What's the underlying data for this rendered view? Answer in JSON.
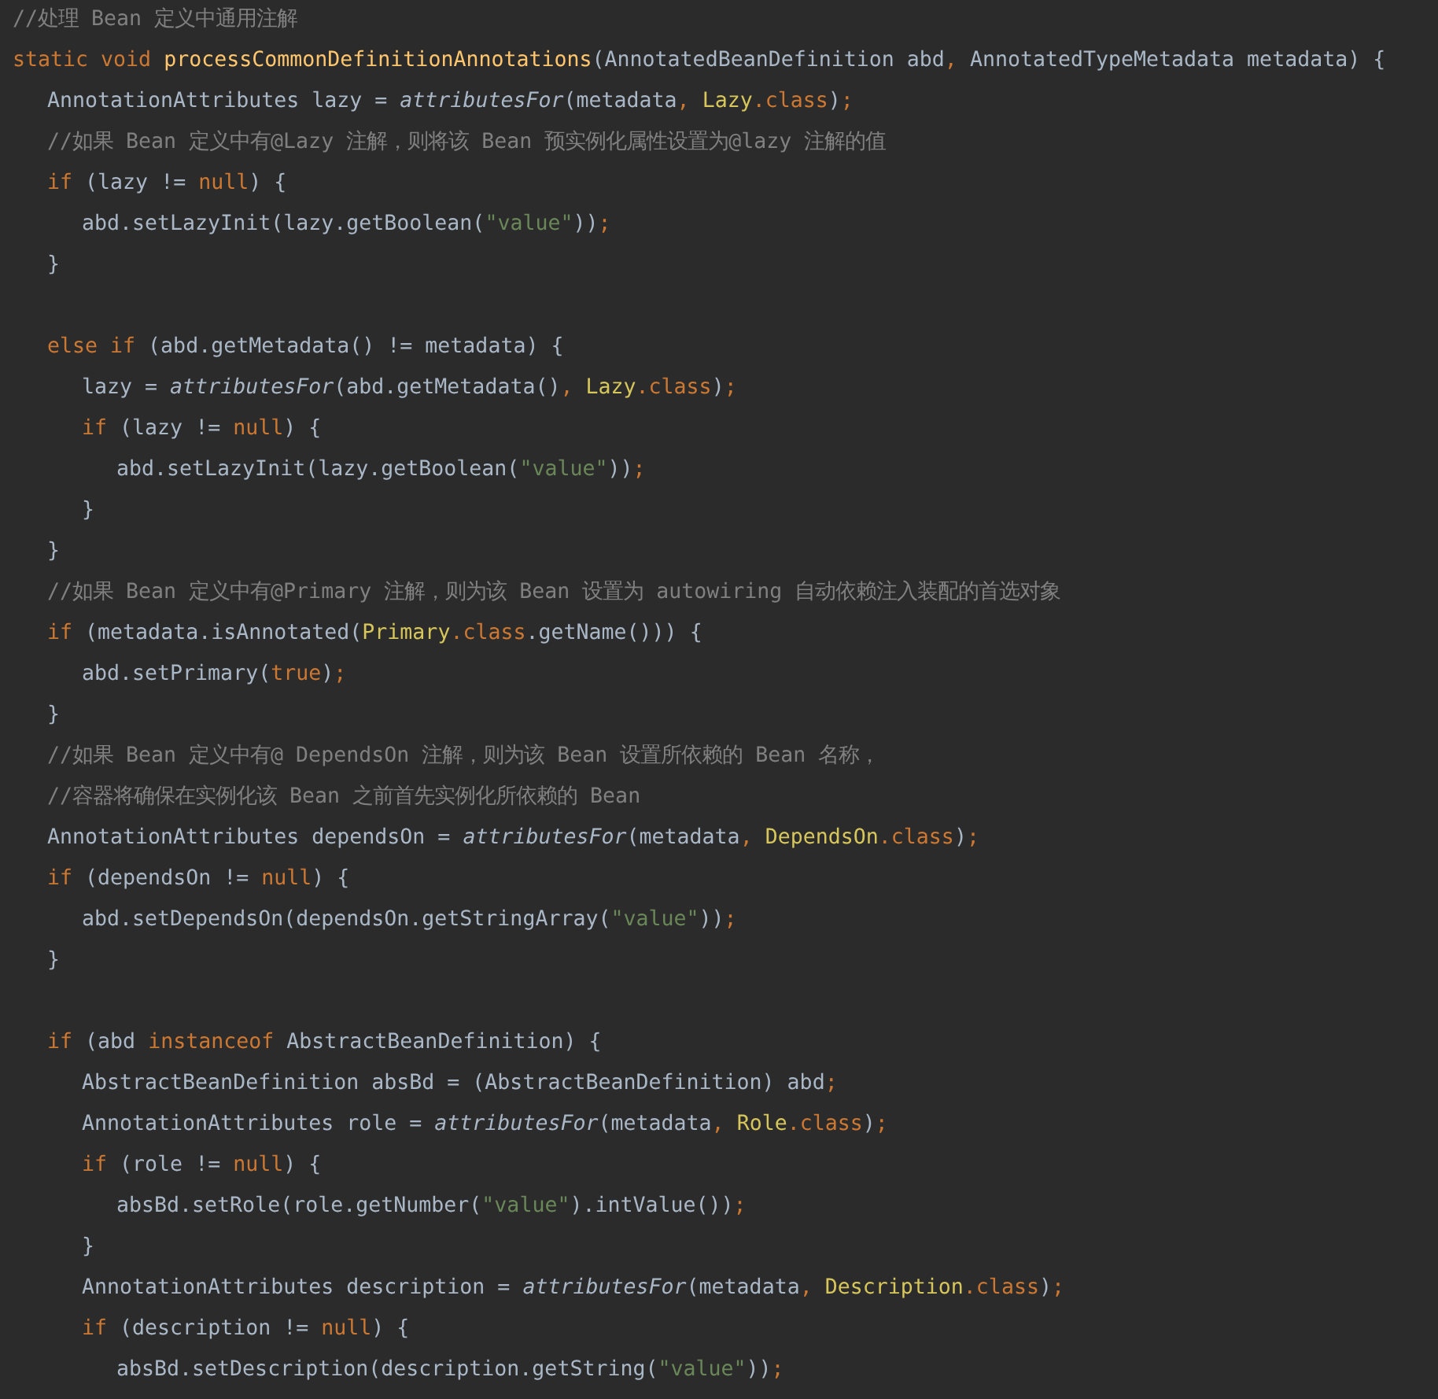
{
  "code_lines": [
    {
      "kind": "code",
      "tokens": [
        {
          "kind": "comment",
          "text": "//处理 Bean 定义中通用注解"
        }
      ]
    },
    {
      "kind": "code",
      "tokens": [
        {
          "kind": "keyword",
          "text": "static void "
        },
        {
          "kind": "method",
          "text": "processCommonDefinitionAnnotations"
        },
        {
          "kind": "plain",
          "text": "(AnnotatedBeanDefinition abd"
        },
        {
          "kind": "keyword",
          "text": ", "
        },
        {
          "kind": "plain",
          "text": "AnnotatedTypeMetadata metadata) {"
        }
      ],
      "children": [
        {
          "kind": "code",
          "tokens": [
            {
              "kind": "plain",
              "text": "AnnotationAttributes lazy = "
            },
            {
              "kind": "italic",
              "text": "attributesFor"
            },
            {
              "kind": "plain",
              "text": "(metadata"
            },
            {
              "kind": "keyword",
              "text": ", "
            },
            {
              "kind": "type",
              "text": "Lazy"
            },
            {
              "kind": "keyword",
              "text": ".class"
            },
            {
              "kind": "plain",
              "text": ")"
            },
            {
              "kind": "keyword",
              "text": ";"
            }
          ]
        },
        {
          "kind": "code",
          "tokens": [
            {
              "kind": "comment",
              "text": "//如果 Bean 定义中有@Lazy 注解，则将该 Bean 预实例化属性设置为@lazy 注解的值"
            }
          ]
        },
        {
          "kind": "code",
          "tokens": [
            {
              "kind": "keyword",
              "text": "if "
            },
            {
              "kind": "plain",
              "text": "(lazy != "
            },
            {
              "kind": "keyword",
              "text": "null"
            },
            {
              "kind": "plain",
              "text": ") {"
            }
          ],
          "children": [
            {
              "kind": "code",
              "tokens": [
                {
                  "kind": "plain",
                  "text": "abd.setLazyInit(lazy.getBoolean("
                },
                {
                  "kind": "string",
                  "text": "\"value\""
                },
                {
                  "kind": "plain",
                  "text": "))"
                },
                {
                  "kind": "keyword",
                  "text": ";"
                }
              ]
            }
          ]
        },
        {
          "kind": "code",
          "tokens": [
            {
              "kind": "plain",
              "text": "}"
            }
          ]
        },
        {
          "kind": "blank"
        },
        {
          "kind": "code",
          "tokens": [
            {
              "kind": "keyword",
              "text": "else if "
            },
            {
              "kind": "plain",
              "text": "(abd.getMetadata() != metadata) {"
            }
          ],
          "children": [
            {
              "kind": "code",
              "tokens": [
                {
                  "kind": "plain",
                  "text": "lazy = "
                },
                {
                  "kind": "italic",
                  "text": "attributesFor"
                },
                {
                  "kind": "plain",
                  "text": "(abd.getMetadata()"
                },
                {
                  "kind": "keyword",
                  "text": ", "
                },
                {
                  "kind": "type",
                  "text": "Lazy"
                },
                {
                  "kind": "keyword",
                  "text": ".class"
                },
                {
                  "kind": "plain",
                  "text": ")"
                },
                {
                  "kind": "keyword",
                  "text": ";"
                }
              ]
            },
            {
              "kind": "code",
              "tokens": [
                {
                  "kind": "keyword",
                  "text": "if "
                },
                {
                  "kind": "plain",
                  "text": "(lazy != "
                },
                {
                  "kind": "keyword",
                  "text": "null"
                },
                {
                  "kind": "plain",
                  "text": ") {"
                }
              ],
              "children": [
                {
                  "kind": "code",
                  "tokens": [
                    {
                      "kind": "plain",
                      "text": "abd.setLazyInit(lazy.getBoolean("
                    },
                    {
                      "kind": "string",
                      "text": "\"value\""
                    },
                    {
                      "kind": "plain",
                      "text": "))"
                    },
                    {
                      "kind": "keyword",
                      "text": ";"
                    }
                  ]
                }
              ]
            },
            {
              "kind": "code",
              "tokens": [
                {
                  "kind": "plain",
                  "text": "}"
                }
              ]
            }
          ]
        },
        {
          "kind": "code",
          "tokens": [
            {
              "kind": "plain",
              "text": "}"
            }
          ]
        },
        {
          "kind": "code",
          "tokens": [
            {
              "kind": "comment",
              "text": "//如果 Bean 定义中有@Primary 注解，则为该 Bean 设置为 autowiring 自动依赖注入装配的首选对象"
            }
          ]
        },
        {
          "kind": "code",
          "tokens": [
            {
              "kind": "keyword",
              "text": "if "
            },
            {
              "kind": "plain",
              "text": "(metadata.isAnnotated("
            },
            {
              "kind": "type",
              "text": "Primary"
            },
            {
              "kind": "keyword",
              "text": ".class"
            },
            {
              "kind": "plain",
              "text": ".getName())) {"
            }
          ],
          "children": [
            {
              "kind": "code",
              "tokens": [
                {
                  "kind": "plain",
                  "text": "abd.setPrimary("
                },
                {
                  "kind": "keyword",
                  "text": "true"
                },
                {
                  "kind": "plain",
                  "text": ")"
                },
                {
                  "kind": "keyword",
                  "text": ";"
                }
              ]
            }
          ]
        },
        {
          "kind": "code",
          "tokens": [
            {
              "kind": "plain",
              "text": "}"
            }
          ]
        },
        {
          "kind": "code",
          "tokens": [
            {
              "kind": "comment",
              "text": "//如果 Bean 定义中有@ DependsOn 注解，则为该 Bean 设置所依赖的 Bean 名称，"
            }
          ]
        },
        {
          "kind": "code",
          "tokens": [
            {
              "kind": "comment",
              "text": "//容器将确保在实例化该 Bean 之前首先实例化所依赖的 Bean"
            }
          ]
        },
        {
          "kind": "code",
          "tokens": [
            {
              "kind": "plain",
              "text": "AnnotationAttributes dependsOn = "
            },
            {
              "kind": "italic",
              "text": "attributesFor"
            },
            {
              "kind": "plain",
              "text": "(metadata"
            },
            {
              "kind": "keyword",
              "text": ", "
            },
            {
              "kind": "type",
              "text": "DependsOn"
            },
            {
              "kind": "keyword",
              "text": ".class"
            },
            {
              "kind": "plain",
              "text": ")"
            },
            {
              "kind": "keyword",
              "text": ";"
            }
          ]
        },
        {
          "kind": "code",
          "tokens": [
            {
              "kind": "keyword",
              "text": "if "
            },
            {
              "kind": "plain",
              "text": "(dependsOn != "
            },
            {
              "kind": "keyword",
              "text": "null"
            },
            {
              "kind": "plain",
              "text": ") {"
            }
          ],
          "children": [
            {
              "kind": "code",
              "tokens": [
                {
                  "kind": "plain",
                  "text": "abd.setDependsOn(dependsOn.getStringArray("
                },
                {
                  "kind": "string",
                  "text": "\"value\""
                },
                {
                  "kind": "plain",
                  "text": "))"
                },
                {
                  "kind": "keyword",
                  "text": ";"
                }
              ]
            }
          ]
        },
        {
          "kind": "code",
          "tokens": [
            {
              "kind": "plain",
              "text": "}"
            }
          ]
        },
        {
          "kind": "blank"
        },
        {
          "kind": "code",
          "tokens": [
            {
              "kind": "keyword",
              "text": "if "
            },
            {
              "kind": "plain",
              "text": "(abd "
            },
            {
              "kind": "keyword",
              "text": "instanceof "
            },
            {
              "kind": "plain",
              "text": "AbstractBeanDefinition) {"
            }
          ],
          "children": [
            {
              "kind": "code",
              "tokens": [
                {
                  "kind": "plain",
                  "text": "AbstractBeanDefinition absBd = (AbstractBeanDefinition) abd"
                },
                {
                  "kind": "keyword",
                  "text": ";"
                }
              ]
            },
            {
              "kind": "code",
              "tokens": [
                {
                  "kind": "plain",
                  "text": "AnnotationAttributes role = "
                },
                {
                  "kind": "italic",
                  "text": "attributesFor"
                },
                {
                  "kind": "plain",
                  "text": "(metadata"
                },
                {
                  "kind": "keyword",
                  "text": ", "
                },
                {
                  "kind": "type",
                  "text": "Role"
                },
                {
                  "kind": "keyword",
                  "text": ".class"
                },
                {
                  "kind": "plain",
                  "text": ")"
                },
                {
                  "kind": "keyword",
                  "text": ";"
                }
              ]
            },
            {
              "kind": "code",
              "tokens": [
                {
                  "kind": "keyword",
                  "text": "if "
                },
                {
                  "kind": "plain",
                  "text": "(role != "
                },
                {
                  "kind": "keyword",
                  "text": "null"
                },
                {
                  "kind": "plain",
                  "text": ") {"
                }
              ],
              "children": [
                {
                  "kind": "code",
                  "tokens": [
                    {
                      "kind": "plain",
                      "text": "absBd.setRole(role.getNumber("
                    },
                    {
                      "kind": "string",
                      "text": "\"value\""
                    },
                    {
                      "kind": "plain",
                      "text": ").intValue())"
                    },
                    {
                      "kind": "keyword",
                      "text": ";"
                    }
                  ]
                }
              ]
            },
            {
              "kind": "code",
              "tokens": [
                {
                  "kind": "plain",
                  "text": "}"
                }
              ]
            },
            {
              "kind": "code",
              "tokens": [
                {
                  "kind": "plain",
                  "text": "AnnotationAttributes description = "
                },
                {
                  "kind": "italic",
                  "text": "attributesFor"
                },
                {
                  "kind": "plain",
                  "text": "(metadata"
                },
                {
                  "kind": "keyword",
                  "text": ", "
                },
                {
                  "kind": "type",
                  "text": "Description"
                },
                {
                  "kind": "keyword",
                  "text": ".class"
                },
                {
                  "kind": "plain",
                  "text": ")"
                },
                {
                  "kind": "keyword",
                  "text": ";"
                }
              ]
            },
            {
              "kind": "code",
              "tokens": [
                {
                  "kind": "keyword",
                  "text": "if "
                },
                {
                  "kind": "plain",
                  "text": "(description != "
                },
                {
                  "kind": "keyword",
                  "text": "null"
                },
                {
                  "kind": "plain",
                  "text": ") {"
                }
              ],
              "children": [
                {
                  "kind": "code",
                  "tokens": [
                    {
                      "kind": "plain",
                      "text": "absBd.setDescription(description.getString("
                    },
                    {
                      "kind": "string",
                      "text": "\"value\""
                    },
                    {
                      "kind": "plain",
                      "text": "))"
                    },
                    {
                      "kind": "keyword",
                      "text": ";"
                    }
                  ]
                }
              ]
            }
          ]
        }
      ]
    }
  ]
}
